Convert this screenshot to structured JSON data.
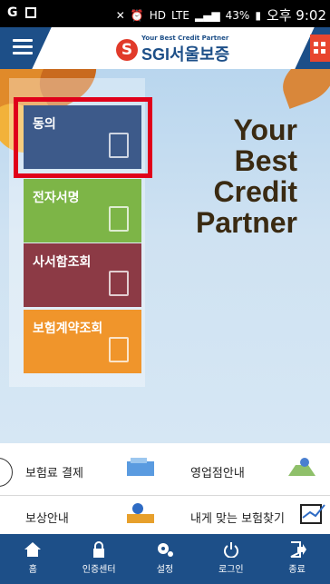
{
  "status_bar": {
    "left_icons": [
      "G",
      "image-icon"
    ],
    "battery": "43%",
    "time": "오후 9:02"
  },
  "header": {
    "logo_tagline": "Your Best Credit Partner",
    "logo_mark": "S",
    "logo_text": "SGI서울보증"
  },
  "slogan": [
    "Your",
    "Best",
    "Credit",
    "Partner"
  ],
  "menu": [
    {
      "label": "동의",
      "icon": "clipboard-check-icon",
      "color": "#3d5a8a"
    },
    {
      "label": "전자서명",
      "icon": "edit-signature-icon",
      "color": "#7db547"
    },
    {
      "label": "사서함조회",
      "icon": "inbox-tray-icon",
      "color": "#8c3a45"
    },
    {
      "label": "보험계약조회",
      "icon": "document-search-icon",
      "color": "#f0952b"
    }
  ],
  "quick_links": [
    {
      "label": "보험료 결제",
      "icon": "card-payment-icon"
    },
    {
      "label": "영업점안내",
      "icon": "map-location-icon"
    },
    {
      "label": "보상안내",
      "icon": "compensation-icon"
    },
    {
      "label": "내게 맞는 보험찾기",
      "icon": "check-chart-icon"
    }
  ],
  "bottom_nav": [
    {
      "label": "홈",
      "icon": "home-icon"
    },
    {
      "label": "인증센터",
      "icon": "lock-icon"
    },
    {
      "label": "설정",
      "icon": "gear-icon"
    },
    {
      "label": "로그인",
      "icon": "power-icon"
    },
    {
      "label": "종료",
      "icon": "exit-icon"
    }
  ],
  "colors": {
    "brand_blue": "#1d4f88",
    "brand_red": "#e13a2a",
    "highlight": "#e0001a"
  }
}
